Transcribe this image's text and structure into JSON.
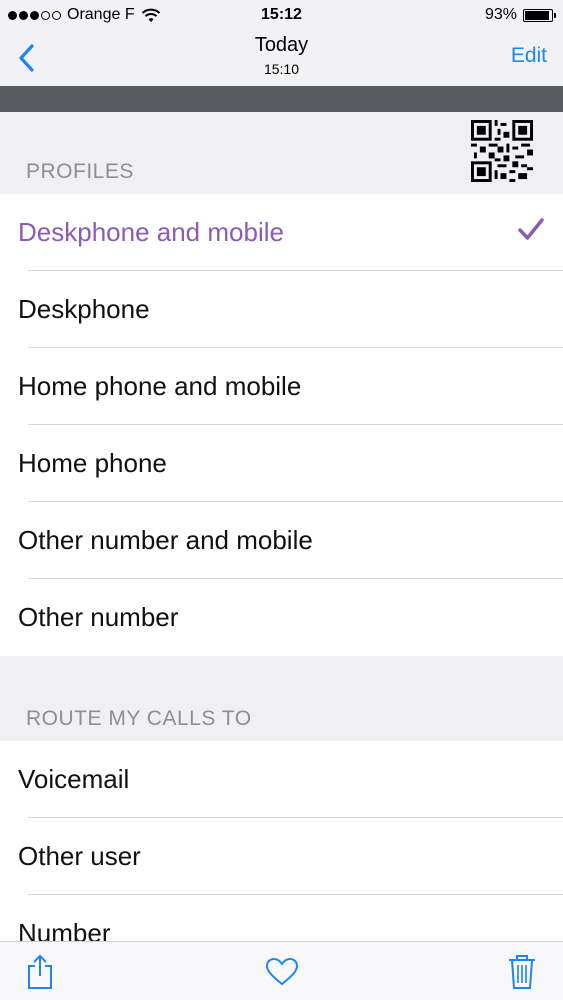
{
  "status": {
    "carrier": "Orange F",
    "time": "15:12",
    "battery_percent": "93%",
    "battery_level": 0.93,
    "signal_strength": 3,
    "signal_total": 5
  },
  "nav": {
    "back_icon": "chevron-left-icon",
    "title": "Today",
    "subtitle": "15:10",
    "edit_label": "Edit",
    "accent_color": "#1e86f4"
  },
  "profiles": {
    "header": "PROFILES",
    "qr_icon": "qr-code-icon",
    "items": [
      {
        "label": "Deskphone and mobile",
        "selected": true
      },
      {
        "label": "Deskphone",
        "selected": false
      },
      {
        "label": "Home phone and mobile",
        "selected": false
      },
      {
        "label": "Home phone",
        "selected": false
      },
      {
        "label": "Other number and mobile",
        "selected": false
      },
      {
        "label": "Other number",
        "selected": false
      }
    ],
    "selected_color": "#8a5cb5"
  },
  "route": {
    "header": "ROUTE MY CALLS TO",
    "items": [
      {
        "label": "Voicemail"
      },
      {
        "label": "Other user"
      },
      {
        "label": "Number"
      }
    ]
  },
  "toolbar": {
    "share_icon": "share-icon",
    "favorite_icon": "heart-icon",
    "delete_icon": "trash-icon",
    "icon_color": "#1e86f4"
  }
}
